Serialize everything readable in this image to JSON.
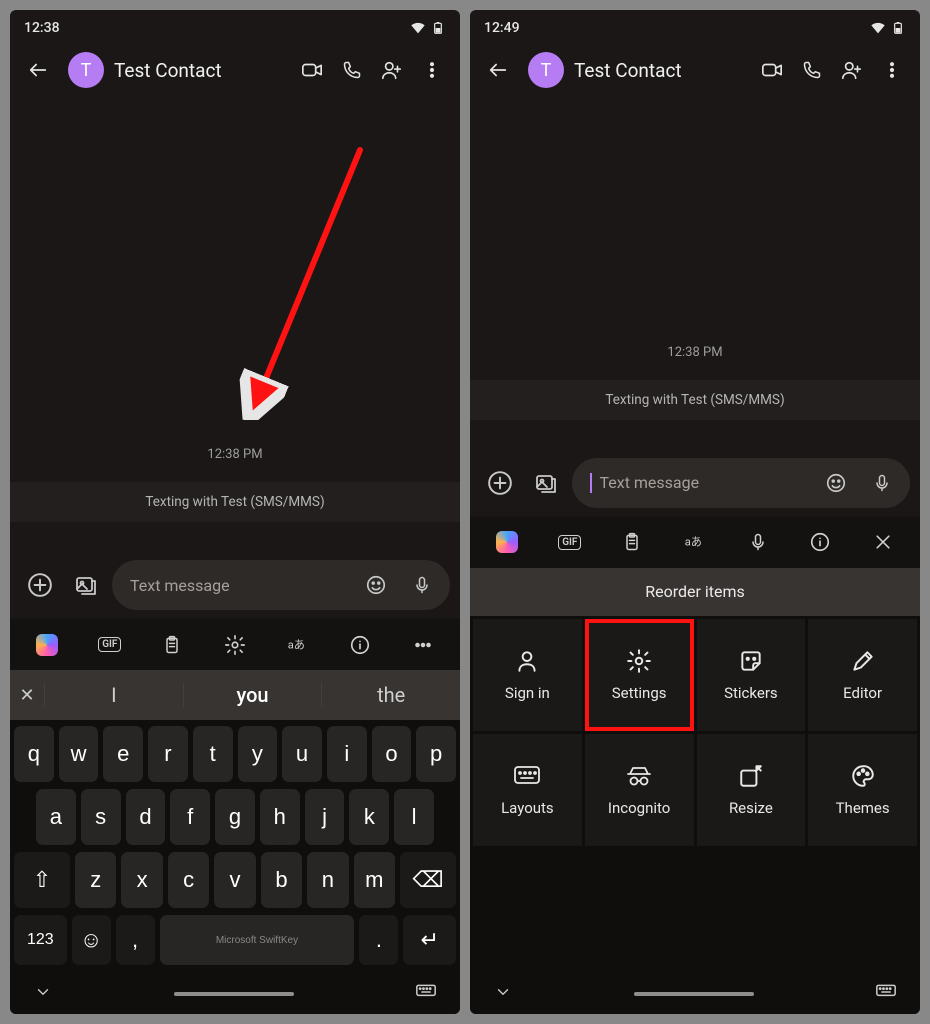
{
  "left": {
    "status_time": "12:38",
    "contact_initial": "T",
    "contact_name": "Test Contact",
    "chat_timestamp": "12:38 PM",
    "sms_banner": "Texting with Test (SMS/MMS)",
    "compose_placeholder": "Text message",
    "suggestions": {
      "close": "✕",
      "s1": "I",
      "s2": "you",
      "s3": "the"
    },
    "kb_rows": {
      "r1": [
        "q",
        "w",
        "e",
        "r",
        "t",
        "y",
        "u",
        "i",
        "o",
        "p"
      ],
      "r2": [
        "a",
        "s",
        "d",
        "f",
        "g",
        "h",
        "j",
        "k",
        "l"
      ],
      "r3_shift": "⇧",
      "r3": [
        "z",
        "x",
        "c",
        "v",
        "b",
        "n",
        "m"
      ],
      "r3_bksp": "⌫",
      "r4_num": "123",
      "r4_emoji": "☺",
      "r4_comma": ",",
      "r4_space": "Microsoft SwiftKey",
      "r4_period": ".",
      "r4_enter": "↵"
    }
  },
  "right": {
    "status_time": "12:49",
    "contact_initial": "T",
    "contact_name": "Test Contact",
    "chat_timestamp": "12:38 PM",
    "sms_banner": "Texting with Test (SMS/MMS)",
    "compose_placeholder": "Text message",
    "reorder_title": "Reorder items",
    "grid": [
      {
        "id": "sign-in",
        "label": "Sign in"
      },
      {
        "id": "settings",
        "label": "Settings"
      },
      {
        "id": "stickers",
        "label": "Stickers"
      },
      {
        "id": "editor",
        "label": "Editor"
      },
      {
        "id": "layouts",
        "label": "Layouts"
      },
      {
        "id": "incognito",
        "label": "Incognito"
      },
      {
        "id": "resize",
        "label": "Resize"
      },
      {
        "id": "themes",
        "label": "Themes"
      }
    ]
  },
  "toolbar_gif": "GIF"
}
